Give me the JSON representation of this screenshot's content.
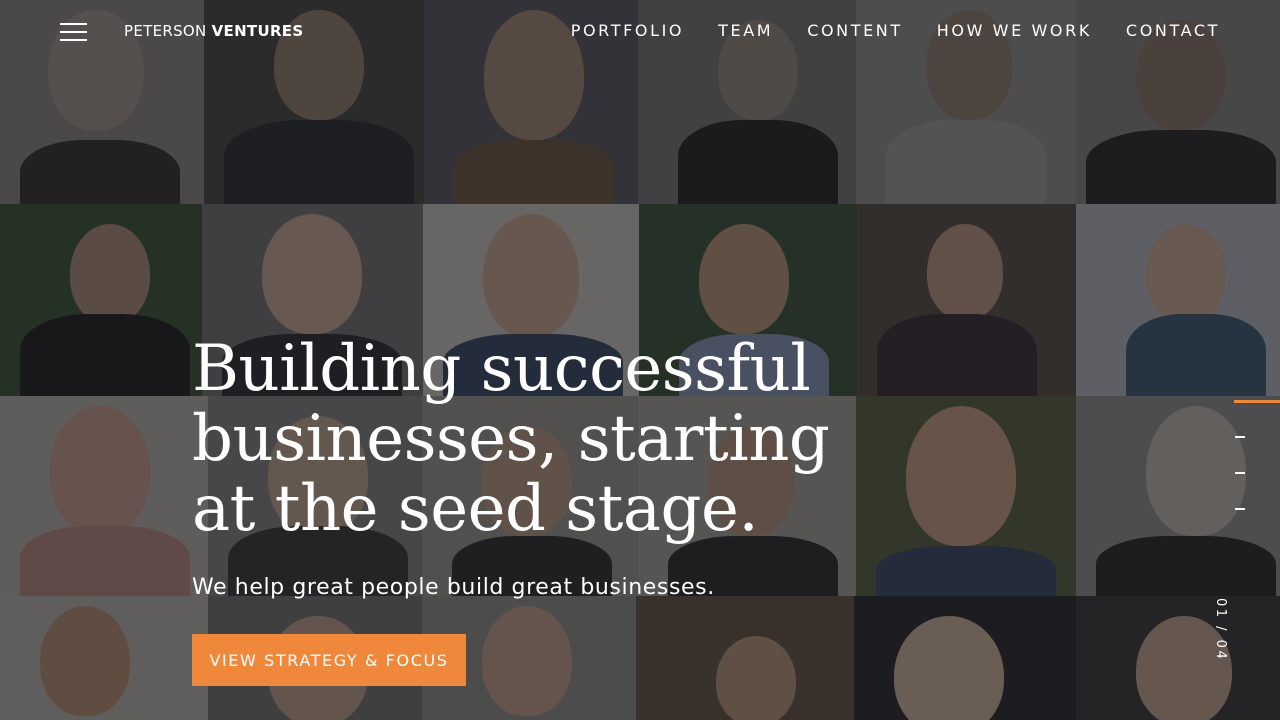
{
  "header": {
    "menu_icon": "hamburger-icon",
    "logo_light": "PETERSON",
    "logo_bold": "VENTURES",
    "nav": [
      {
        "label": "PORTFOLIO"
      },
      {
        "label": "TEAM"
      },
      {
        "label": "CONTENT"
      },
      {
        "label": "HOW WE WORK"
      },
      {
        "label": "CONTACT"
      }
    ]
  },
  "hero": {
    "title": "Building successful businesses, starting at the seed stage.",
    "subtitle": "We help great people build great businesses.",
    "cta_label": "VIEW STRATEGY & FOCUS"
  },
  "slider": {
    "counter": "01 / 04",
    "current": 1,
    "total": 4
  },
  "colors": {
    "accent": "#f0883b",
    "text": "#ffffff",
    "overlay": "#141418"
  }
}
